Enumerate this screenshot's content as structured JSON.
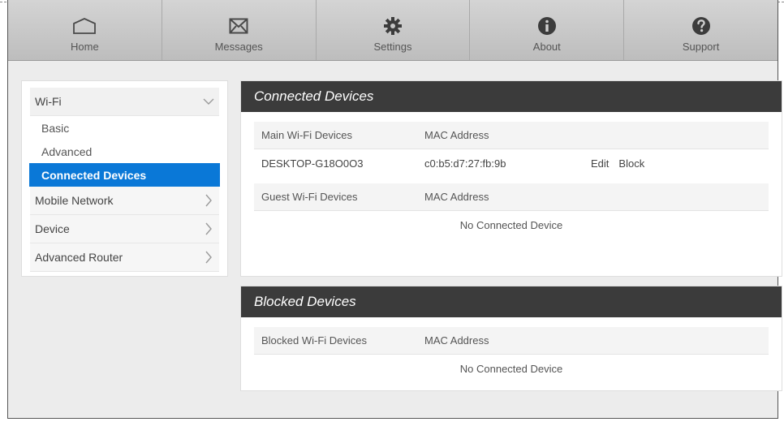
{
  "nav": {
    "items": [
      {
        "label": "Home",
        "icon": "home-icon"
      },
      {
        "label": "Messages",
        "icon": "envelope-icon"
      },
      {
        "label": "Settings",
        "icon": "gear-icon"
      },
      {
        "label": "About",
        "icon": "info-icon"
      },
      {
        "label": "Support",
        "icon": "question-icon"
      }
    ]
  },
  "sidebar": {
    "wifi": {
      "label": "Wi-Fi",
      "subitems": [
        "Basic",
        "Advanced",
        "Connected Devices"
      ],
      "active": "Connected Devices"
    },
    "items": [
      "Mobile Network",
      "Device",
      "Advanced Router"
    ]
  },
  "connected": {
    "title": "Connected Devices",
    "main": {
      "col1": "Main Wi-Fi Devices",
      "col2": "MAC Address",
      "rows": [
        {
          "name": "DESKTOP-G18O0O3",
          "mac": "c0:b5:d7:27:fb:9b",
          "edit": "Edit",
          "block": "Block"
        }
      ]
    },
    "guest": {
      "col1": "Guest Wi-Fi Devices",
      "col2": "MAC Address",
      "empty": "No Connected Device"
    }
  },
  "blocked": {
    "title": "Blocked Devices",
    "col1": "Blocked Wi-Fi Devices",
    "col2": "MAC Address",
    "empty": "No Connected Device"
  },
  "colors": {
    "nav_bg": "#c6c6c6",
    "panel_header": "#3b3b3b",
    "active_item": "#0a78d7",
    "page_bg": "#ececec"
  }
}
